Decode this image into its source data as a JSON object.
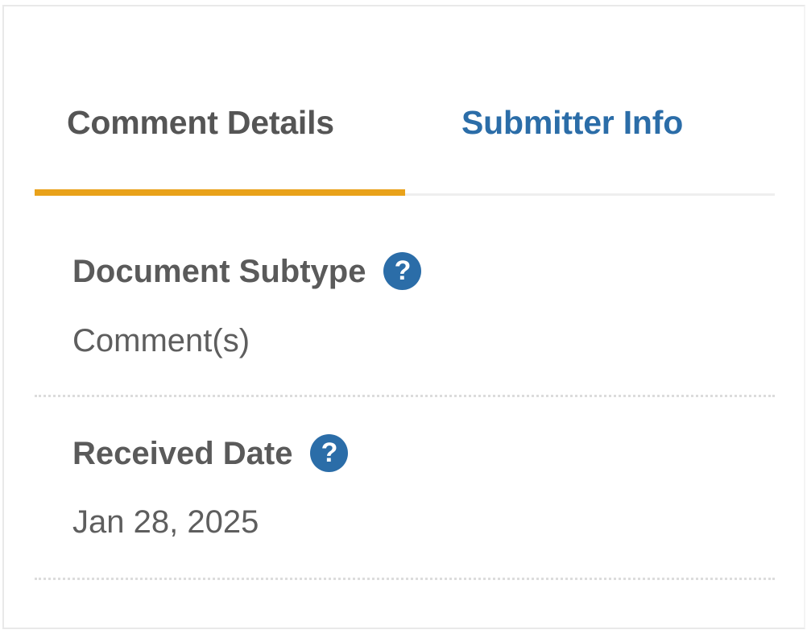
{
  "tabs": [
    {
      "label": "Comment Details",
      "active": true
    },
    {
      "label": "Submitter Info",
      "active": false
    }
  ],
  "fields": [
    {
      "label": "Document Subtype",
      "value": "Comment(s)",
      "help_icon": "question-circle-icon"
    },
    {
      "label": "Received Date",
      "value": "Jan 28, 2025",
      "help_icon": "question-circle-icon"
    }
  ],
  "icons": {
    "help_glyph": "?"
  },
  "colors": {
    "active_tab_text": "#555555",
    "inactive_tab_text": "#2b6da8",
    "active_indicator": "#e9a21a",
    "help_icon_bg": "#2b6da8",
    "label_text": "#5a5a5a",
    "value_text": "#5e5e5e"
  }
}
